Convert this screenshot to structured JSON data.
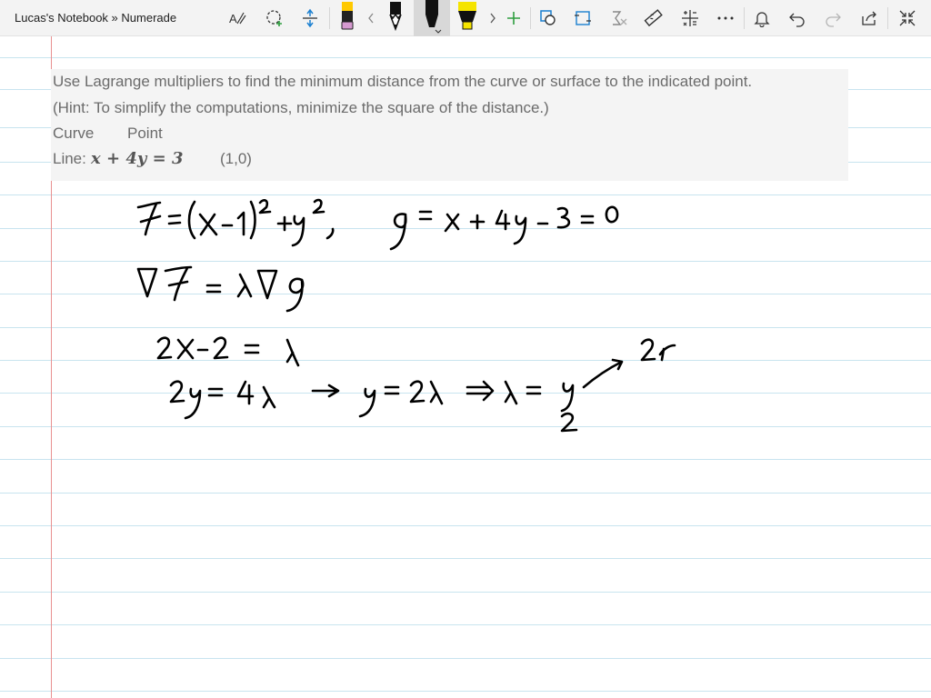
{
  "window": {
    "title": "Lucas's Notebook » Numerade"
  },
  "toolbar": {
    "tools": [
      {
        "name": "text-to-ink",
        "icon": "text-ink-icon"
      },
      {
        "name": "lasso-select",
        "icon": "lasso-icon"
      },
      {
        "name": "add-space",
        "icon": "add-space-icon"
      },
      {
        "name": "pen-pink",
        "icon": "pen-icon",
        "color": "#d69ad0"
      },
      {
        "name": "scroll-left",
        "icon": "chevron-left-icon"
      },
      {
        "name": "pen-pencil",
        "icon": "pencil-icon",
        "color": "#111111"
      },
      {
        "name": "pen-black-selected",
        "icon": "pen-icon",
        "color": "#111111"
      },
      {
        "name": "highlighter-yellow",
        "icon": "highlighter-icon",
        "color": "#f5e400"
      },
      {
        "name": "scroll-right",
        "icon": "chevron-right-icon"
      },
      {
        "name": "add-pen",
        "icon": "plus-icon",
        "color": "#2e9e3f"
      },
      {
        "name": "shapes",
        "icon": "shapes-icon"
      },
      {
        "name": "ink-to-shape",
        "icon": "ink-to-shape-icon"
      },
      {
        "name": "ink-to-math",
        "icon": "ink-math-icon"
      },
      {
        "name": "ruler",
        "icon": "ruler-icon"
      },
      {
        "name": "math-tools",
        "icon": "math-icon"
      },
      {
        "name": "more",
        "icon": "more-icon"
      },
      {
        "name": "notifications",
        "icon": "bell-icon"
      },
      {
        "name": "undo",
        "icon": "undo-icon"
      },
      {
        "name": "redo",
        "icon": "redo-icon"
      },
      {
        "name": "share",
        "icon": "share-icon"
      },
      {
        "name": "fullscreen",
        "icon": "collapse-icon"
      }
    ]
  },
  "problem": {
    "line1": "Use Lagrange multipliers to find the minimum distance from the curve or surface to the indicated point.",
    "line2": "(Hint: To simplify the computations, minimize the square of the distance.)",
    "col_curve": "Curve",
    "col_point": "Point",
    "curve_label": "Line:",
    "curve_equation": "x + 4y = 3",
    "point": "(1,0)"
  },
  "colors": {
    "toolbar_bg": "#f3f3f3",
    "rule_line": "#c8e4ef",
    "margin_line": "#e99090",
    "problem_bg": "#f4f4f4",
    "problem_text": "#6b6b6b",
    "ink": "#000000",
    "accent_green": "#2e9e3f",
    "accent_blue": "#1a7fd0"
  },
  "handwriting": {
    "line1": "f = (x-1)² + y² ,   g = x + 4y - 3 = 0",
    "line2": "∇f = λ∇g",
    "line3": "2x-2 = λ",
    "line4": "2y = 4λ → y = 2λ ⇒ λ = y/2 ↗ 2x"
  }
}
